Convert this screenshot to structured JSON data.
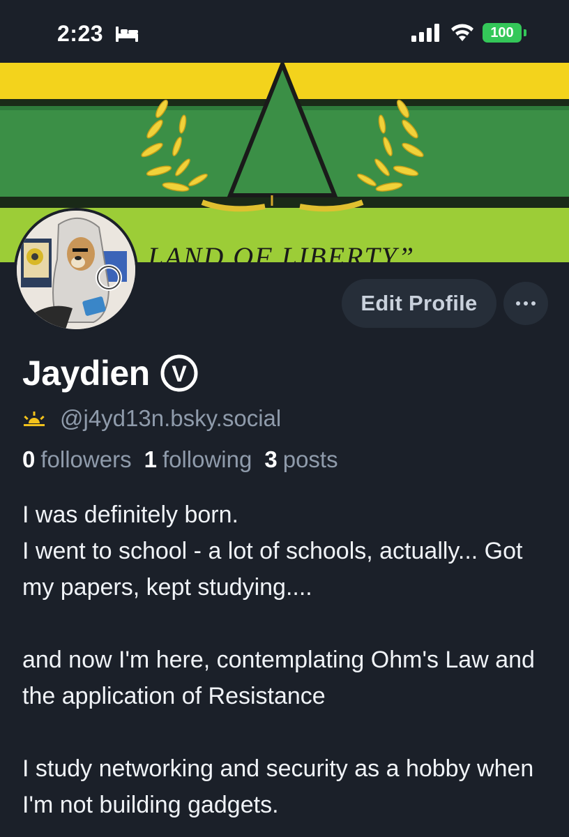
{
  "status_bar": {
    "time": "2:23",
    "battery": "100",
    "icons": [
      "bed-icon",
      "signal-icon",
      "wifi-icon",
      "battery-icon"
    ]
  },
  "banner": {
    "text": "LAND OF LIBERTY”"
  },
  "profile": {
    "display_name": "Jaydien",
    "verified_glyph": "V",
    "handle": "@j4yd13n.bsky.social",
    "followers_count": "0",
    "followers_label": "followers",
    "following_count": "1",
    "following_label": "following",
    "posts_count": "3",
    "posts_label": "posts",
    "bio": "I was definitely born.\nI went to school - a lot of schools, actually... Got my papers, kept studying....\n\nand now I'm here, contemplating Ohm's Law and the application of Resistance\n\nI study networking and security as a hobby when I'm not building gadgets."
  },
  "actions": {
    "edit_profile_label": "Edit Profile",
    "more_label": "···"
  },
  "colors": {
    "background": "#1b2029",
    "button_bg": "#262e39",
    "muted_text": "#8f9bab",
    "battery_green": "#34c759",
    "flag_yellow": "#f3d31c",
    "flag_green": "#3b8f46",
    "flag_lime": "#9ccd37"
  }
}
